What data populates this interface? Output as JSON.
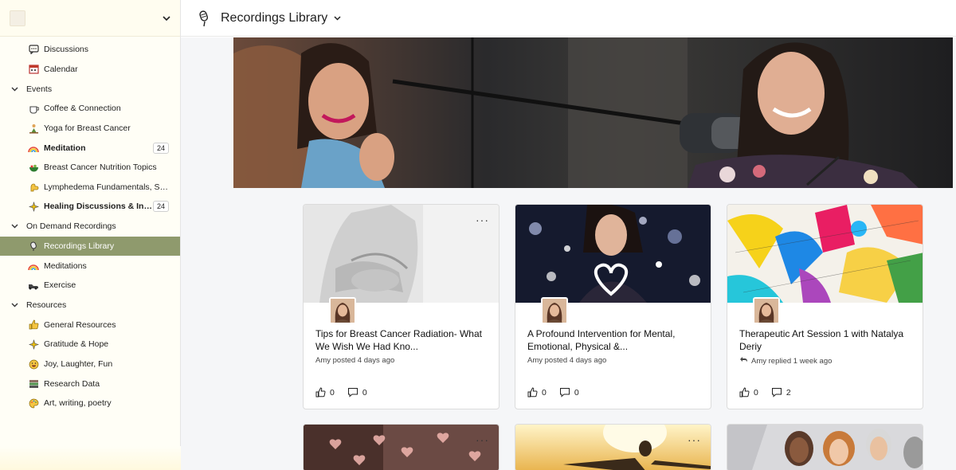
{
  "header": {
    "title": "Recordings Library"
  },
  "sidebar": {
    "top_items": [
      {
        "label": "Discussions",
        "icon": "chat-icon"
      },
      {
        "label": "Calendar",
        "icon": "calendar-icon"
      }
    ],
    "groups": [
      {
        "label": "Events",
        "items": [
          {
            "label": "Coffee & Connection",
            "icon": "coffee-icon"
          },
          {
            "label": "Yoga for Breast Cancer",
            "icon": "yoga-icon"
          },
          {
            "label": "Meditation",
            "icon": "rainbow-icon",
            "bold": true,
            "count": "24"
          },
          {
            "label": "Breast Cancer Nutrition Topics",
            "icon": "salad-icon"
          },
          {
            "label": "Lymphedema Fundamentals, Se...",
            "icon": "arm-icon"
          },
          {
            "label": "Healing Discussions & Int...",
            "icon": "sparkle-icon",
            "bold": true,
            "count": "24"
          }
        ]
      },
      {
        "label": "On Demand Recordings",
        "items": [
          {
            "label": "Recordings Library",
            "icon": "microphone-icon",
            "active": true
          },
          {
            "label": "Meditations",
            "icon": "rainbow-icon"
          },
          {
            "label": "Exercise",
            "icon": "shoe-icon"
          }
        ]
      },
      {
        "label": "Resources",
        "items": [
          {
            "label": "General Resources",
            "icon": "thumbs-up-icon"
          },
          {
            "label": "Gratitude & Hope",
            "icon": "sparkle-icon"
          },
          {
            "label": "Joy, Laughter, Fun",
            "icon": "smile-icon"
          },
          {
            "label": "Research Data",
            "icon": "books-icon"
          },
          {
            "label": "Art, writing, poetry",
            "icon": "palette-icon"
          }
        ]
      }
    ]
  },
  "cards": [
    {
      "title": "Tips for Breast Cancer Radiation- What We Wish We Had Kno...",
      "meta": "Amy posted 4 days ago",
      "likes": "0",
      "comments": "0",
      "replied": false
    },
    {
      "title": "A Profound Intervention for Mental, Emotional, Physical &...",
      "meta": "Amy posted 4 days ago",
      "likes": "0",
      "comments": "0",
      "replied": false
    },
    {
      "title": "Therapeutic Art Session 1 with Natalya Deriy",
      "meta": "Amy replied 1 week ago",
      "likes": "0",
      "comments": "2",
      "replied": true
    }
  ],
  "colors": {
    "active_nav": "#8f9a6d",
    "sidebar_bg": "#fffef6"
  }
}
